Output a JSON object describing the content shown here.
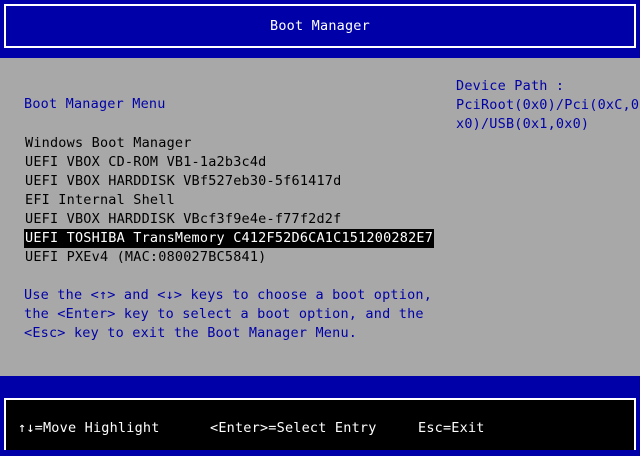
{
  "title": "Boot Manager",
  "menu_heading": "Boot Manager Menu",
  "boot_entries": [
    {
      "label": "Windows Boot Manager",
      "selected": false
    },
    {
      "label": "UEFI VBOX CD-ROM VB1-1a2b3c4d",
      "selected": false
    },
    {
      "label": "UEFI VBOX HARDDISK VBf527eb30-5f61417d",
      "selected": false
    },
    {
      "label": "EFI Internal Shell",
      "selected": false
    },
    {
      "label": "UEFI VBOX HARDDISK VBcf3f9e4e-f77f2d2f",
      "selected": false
    },
    {
      "label": "UEFI TOSHIBA TransMemory C412F52D6CA1C151200282E7",
      "selected": true
    },
    {
      "label": "UEFI PXEv4 (MAC:080027BC5841)",
      "selected": false
    }
  ],
  "help_lines": [
    "Use the <↑> and <↓> keys to choose a boot option,",
    "the <Enter> key to select a boot option, and the",
    "<Esc> key to exit the Boot Manager Menu."
  ],
  "device_path": {
    "label": "Device Path :",
    "lines": [
      "PciRoot(0x0)/Pci(0xC,0",
      "x0)/USB(0x1,0x0)"
    ]
  },
  "footer": {
    "move_hint": "↑↓=Move Highlight",
    "select_hint": "<Enter>=Select Entry",
    "exit_hint": "Esc=Exit"
  },
  "colors": {
    "background": "#0000a8",
    "panel": "#a8a8a8",
    "highlight": "#000000",
    "text_blue": "#0000a8"
  }
}
